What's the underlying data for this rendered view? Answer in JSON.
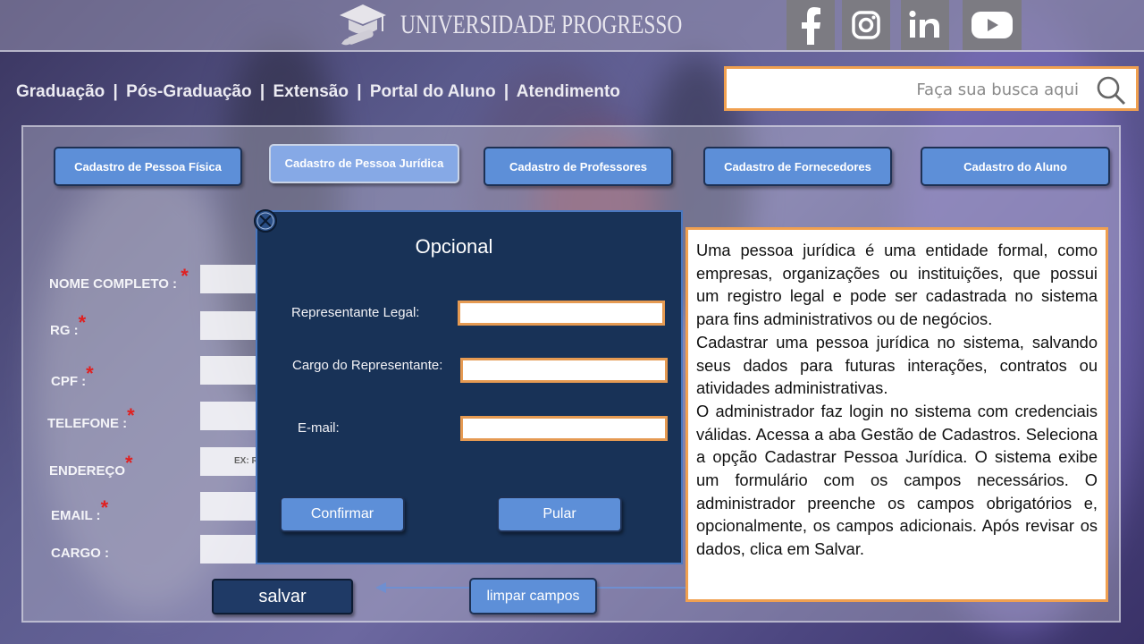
{
  "header": {
    "title": "UNIVERSIDADE PROGRESSO",
    "social": [
      "facebook-icon",
      "instagram-icon",
      "linkedin-icon",
      "youtube-icon"
    ]
  },
  "nav": {
    "items": [
      "Graduação",
      "Pós-Graduação",
      "Extensão",
      "Portal do Aluno",
      "Atendimento"
    ],
    "separator": "|"
  },
  "search": {
    "placeholder": "Faça sua busca aqui"
  },
  "tabs": [
    {
      "label": "Cadastro de Pessoa Física",
      "active": false
    },
    {
      "label": "Cadastro de Pessoa Jurídica",
      "active": true
    },
    {
      "label": "Cadastro de Professores",
      "active": false
    },
    {
      "label": "Cadastro de  Fornecedores",
      "active": false
    },
    {
      "label": "Cadastro do Aluno",
      "active": false
    }
  ],
  "form": {
    "fields": [
      {
        "label": "NOME COMPLETO :",
        "required": "*"
      },
      {
        "label": "RG :",
        "required": "*"
      },
      {
        "label": "CPF :",
        "required": "*"
      },
      {
        "label": "TELEFONE :",
        "required": "*"
      },
      {
        "label": "ENDEREÇO",
        "required": "*"
      },
      {
        "label": "EMAIL :",
        "required": "*"
      },
      {
        "label": "CARGO :",
        "required": ""
      }
    ],
    "address_hint": "EX: R",
    "save_label": "salvar",
    "clear_label": "limpar campos"
  },
  "modal": {
    "title": "Opcional",
    "fields": [
      {
        "label": "Representante Legal:",
        "value": ""
      },
      {
        "label": "Cargo do Representante:",
        "value": ""
      },
      {
        "label": "E-mail:",
        "value": ""
      }
    ],
    "confirm_label": "Confirmar",
    "skip_label": "Pular"
  },
  "info": {
    "paragraphs": [
      "Uma pessoa jurídica é uma entidade formal, como empresas, organizações ou instituições, que possui um registro legal e pode ser cadastrada no sistema para fins administrativos ou de negócios.",
      "Cadastrar uma pessoa jurídica no sistema, salvando seus dados para futuras interações, contratos ou atividades administrativas.",
      "O administrador faz login no sistema com credenciais válidas. Acessa a aba Gestão de Cadastros. Seleciona a opção Cadastrar Pessoa Jurídica. O sistema exibe um formulário com os campos necessários. O administrador preenche os campos obrigatórios e, opcionalmente, os campos adicionais. Após revisar os dados, clica em Salvar."
    ]
  },
  "colors": {
    "accent_orange": "#f0a050",
    "tab_blue": "#5d8fd8",
    "modal_navy": "#183257",
    "required_red": "#e02020"
  }
}
